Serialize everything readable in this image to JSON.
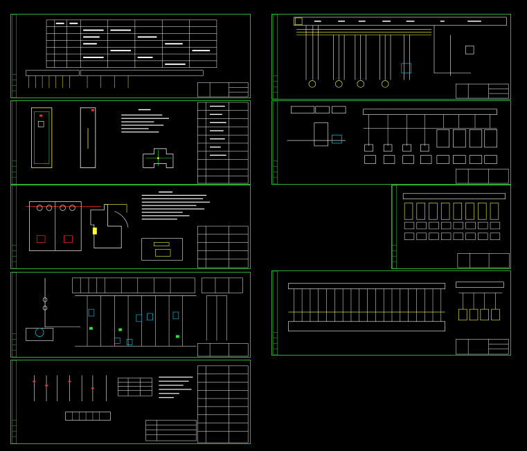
{
  "app": {
    "title": "",
    "background": "#000000",
    "frame_color": "#2fae2f",
    "line_white": "#ffffff",
    "line_cyan": "#00d8ff",
    "line_yellow": "#ffff40",
    "line_red": "#ff2a2a",
    "line_green": "#30e030"
  },
  "sheets": [
    {
      "id": "sheet-1",
      "kind": "terminal-table"
    },
    {
      "id": "sheet-2",
      "kind": "cabinet-outline"
    },
    {
      "id": "sheet-3",
      "kind": "panel-layout"
    },
    {
      "id": "sheet-4",
      "kind": "control-circuit"
    },
    {
      "id": "sheet-5",
      "kind": "wiring-notes"
    },
    {
      "id": "sheet-6",
      "kind": "main-circuit"
    },
    {
      "id": "sheet-7",
      "kind": "plc-system"
    },
    {
      "id": "sheet-8",
      "kind": "plc-io-modules"
    },
    {
      "id": "sheet-9",
      "kind": "plc-io-wiring"
    }
  ]
}
